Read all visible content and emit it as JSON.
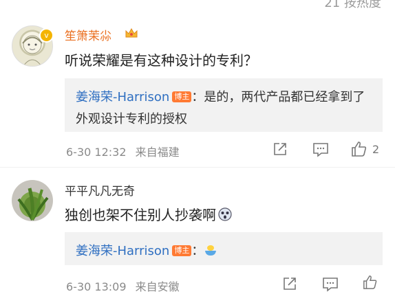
{
  "top_cut_text": "21 按热度",
  "comments": [
    {
      "username": "笙箫茉尛",
      "text": "听说荣耀是有这种设计的专利？",
      "reply": {
        "name": "姜海荣-Harrison",
        "tag": "博主",
        "text": "：是的，两代产品都已经拿到了外观设计专利的授权"
      },
      "time": "6-30 12:32",
      "source": "来自福建",
      "like_count": "2"
    },
    {
      "username": "平平凡凡无奇",
      "text": "独创也架不住别人抄袭啊",
      "reply": {
        "name": "姜海荣-Harrison",
        "tag": "博主",
        "text": "："
      },
      "time": "6-30 13:09",
      "source": "来自安徽"
    }
  ]
}
